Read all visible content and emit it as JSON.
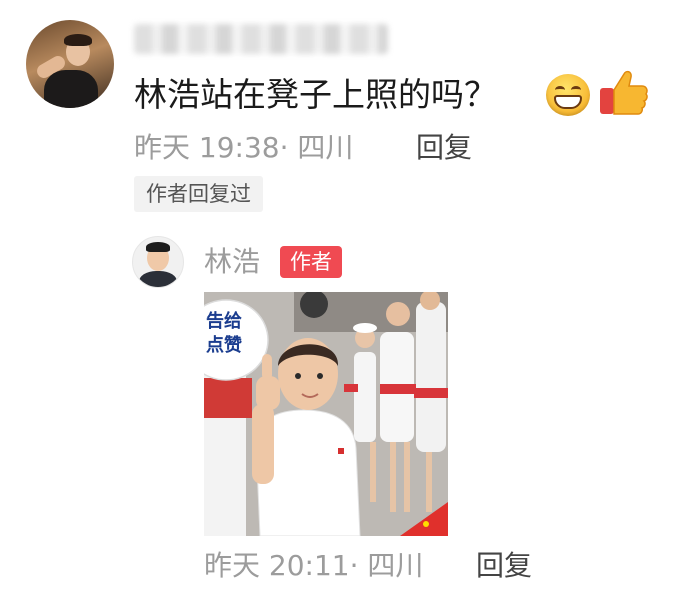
{
  "comment": {
    "username": "",
    "text": "林浩站在凳子上照的吗？",
    "emojis": [
      "grinning-face-icon",
      "thumbs-up-icon"
    ],
    "time": "昨天 19:38",
    "separator": "·",
    "location": "四川",
    "reply_label": "回复",
    "author_replied_label": "作者回复过"
  },
  "reply": {
    "username": "林浩",
    "author_badge": "作者",
    "image": {
      "caption_line1": "告给",
      "caption_line2": "点赞"
    },
    "time": "昨天 20:11",
    "separator": "·",
    "location": "四川",
    "reply_label": "回复"
  },
  "colors": {
    "text_primary": "#1a1a1a",
    "text_meta": "#9c9c9c",
    "reply_link": "#444444",
    "author_badge_bg": "#f04a52",
    "tag_bg": "#f2f2f2"
  }
}
